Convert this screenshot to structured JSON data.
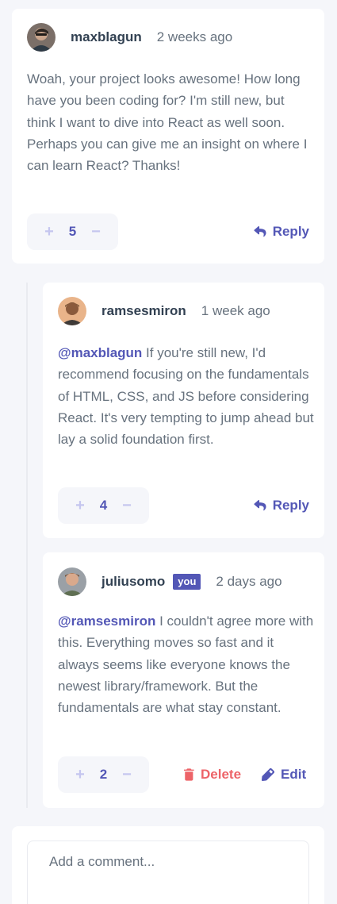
{
  "comments": [
    {
      "username": "maxblagun",
      "time": "2 weeks ago",
      "mention": "",
      "text": " Woah, your project looks awesome! How long have you been coding for? I'm still new, but think I want to dive into React as well soon. Perhaps you can give me an insight on where I can learn React? Thanks!",
      "score": "5",
      "plus": "+",
      "minus": "−",
      "action": "Reply"
    }
  ],
  "replies": [
    {
      "username": "ramsesmiron",
      "time": "1 week ago",
      "mention": "@maxblagun",
      "text": " If you're still new, I'd recommend focusing on the fundamentals of HTML, CSS, and JS before considering React. It's very tempting to jump ahead but lay a solid foundation first.",
      "score": "4",
      "plus": "+",
      "minus": "−",
      "action": "Reply"
    },
    {
      "username": "juliusomo",
      "badge": "you",
      "time": "2 days ago",
      "mention": "@ramsesmiron",
      "text": " I couldn't agree more with this. Everything moves so fast and it always seems like everyone knows the newest library/framework. But the fundamentals are what stay constant.",
      "score": "2",
      "plus": "+",
      "minus": "−",
      "delete_label": "Delete",
      "edit_label": "Edit"
    }
  ],
  "add_comment": {
    "placeholder": "Add a comment..."
  },
  "colors": {
    "accent": "#5357b6",
    "danger": "#ed6368",
    "background": "#f5f6fa",
    "muted_icon": "#c5c6ef"
  },
  "icons": {
    "reply": "reply-icon",
    "delete": "trash-icon",
    "edit": "pencil-icon"
  }
}
